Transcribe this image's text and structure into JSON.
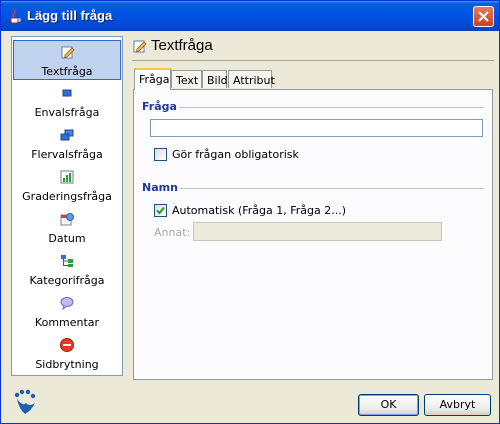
{
  "window": {
    "title": "Lägg till fråga"
  },
  "sidebar": {
    "items": [
      {
        "label": "Textfråga",
        "icon": "pencil-doc-icon",
        "selected": true
      },
      {
        "label": "Envalsfråga",
        "icon": "single-choice-icon",
        "selected": false
      },
      {
        "label": "Flervalsfråga",
        "icon": "multi-choice-icon",
        "selected": false
      },
      {
        "label": "Graderingsfråga",
        "icon": "bar-chart-icon",
        "selected": false
      },
      {
        "label": "Datum",
        "icon": "calendar-icon",
        "selected": false
      },
      {
        "label": "Kategorifråga",
        "icon": "tree-icon",
        "selected": false
      },
      {
        "label": "Kommentar",
        "icon": "speech-bubble-icon",
        "selected": false
      },
      {
        "label": "Sidbrytning",
        "icon": "stop-sign-icon",
        "selected": false
      }
    ]
  },
  "main": {
    "title": "Textfråga",
    "tabs": [
      {
        "label": "Fråga",
        "active": true
      },
      {
        "label": "Text",
        "active": false
      },
      {
        "label": "Bild",
        "active": false
      },
      {
        "label": "Attribut",
        "active": false
      }
    ],
    "question_section": {
      "heading": "Fråga",
      "input_value": "",
      "mandatory_label": "Gör frågan obligatorisk",
      "mandatory_checked": false
    },
    "name_section": {
      "heading": "Namn",
      "automatic_label": "Automatisk (Fråga 1, Fråga 2...)",
      "automatic_checked": true,
      "other_label": "Annat:",
      "other_value": ""
    }
  },
  "buttons": {
    "ok": "OK",
    "cancel": "Avbryt"
  },
  "colors": {
    "titlebar": "#0055e5",
    "section_heading": "#21389d",
    "selection": "#c1d2ee"
  }
}
